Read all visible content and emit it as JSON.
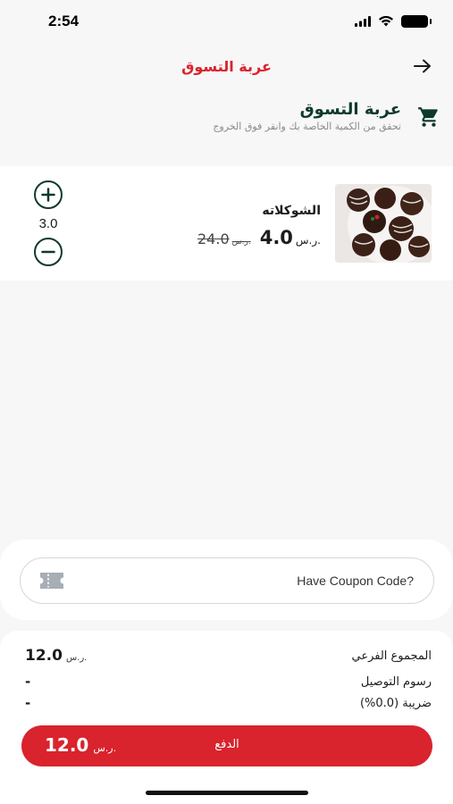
{
  "status_bar": {
    "time": "2:54"
  },
  "app_bar": {
    "title": "عربة التسوق"
  },
  "cart_header": {
    "title": "عربة التسوق",
    "subtitle": "تحقق من الكمية الخاصة بك وانقر فوق الخروج"
  },
  "cart_items": [
    {
      "name": "الشوكلاته",
      "price": "4.0",
      "currency": "ر.س.",
      "old_price": "24.0",
      "old_currency": "ر.س.",
      "quantity": "3.0"
    }
  ],
  "coupon": {
    "label": "Have Coupon Code?"
  },
  "summary": {
    "subtotal_label": "المجموع الفرعي",
    "subtotal_value": "12.0",
    "subtotal_currency": "ر.س.",
    "delivery_label": "رسوم التوصيل",
    "delivery_value": "-",
    "tax_label": "ضريبة (0.0%)",
    "tax_value": "-"
  },
  "pay_button": {
    "label": "الدفع",
    "total": "12.0",
    "currency": "ر.س."
  },
  "colors": {
    "accent": "#d9232d",
    "dark_green": "#0f3a2a",
    "background": "#f7f7f7"
  },
  "icons": [
    "wifi-icon",
    "battery-icon",
    "arrow-right-icon",
    "cart-icon",
    "plus-circle-icon",
    "minus-circle-icon",
    "coupon-ticket-icon"
  ]
}
